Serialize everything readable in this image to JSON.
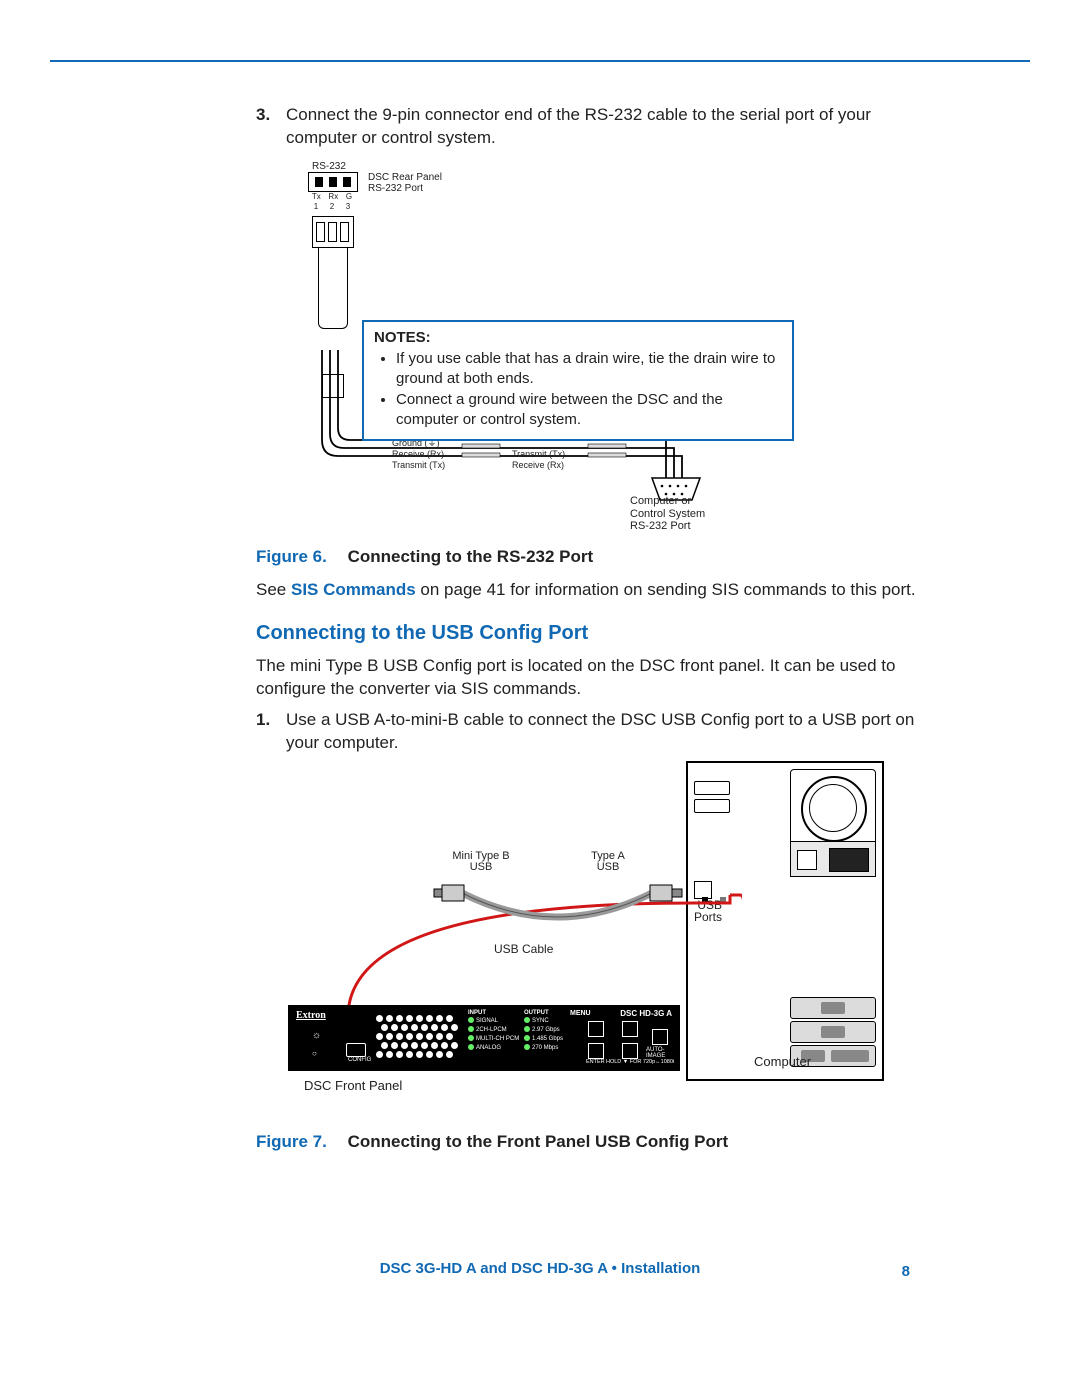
{
  "step3": {
    "num": "3.",
    "text": "Connect the 9-pin connector end of the RS-232 cable to the serial port of your computer or control system."
  },
  "fig6": {
    "rs232": "RS-232",
    "rear_label_l1": "DSC Rear Panel",
    "rear_label_l2": "RS-232 Port",
    "pins": {
      "tx": "Tx",
      "rx": "Rx",
      "g": "G",
      "n1": "1",
      "n2": "2",
      "n3": "3"
    },
    "wires_left": [
      "Ground (⏚)",
      "Receive (Rx)",
      "Transmit (Tx)"
    ],
    "wires_right": [
      "Transmit (Tx)",
      "Receive (Rx)"
    ],
    "computer_l1": "Computer or",
    "computer_l2": "Control System",
    "computer_l3": "RS-232 Port",
    "notes_title": "NOTES:",
    "notes": [
      "If you use cable that has a drain wire, tie the drain wire to ground at both ends.",
      "Connect a ground wire between the DSC and the computer or control system."
    ],
    "caption_link": "Figure 6.",
    "caption_title": "Connecting to the RS-232 Port"
  },
  "sis_para": {
    "pre": "See ",
    "link": "SIS Commands",
    "post": " on page 41 for information on sending SIS commands to this port."
  },
  "section_title": "Connecting to the USB Config Port",
  "usb_intro": "The mini Type B USB Config port is located on the DSC front panel. It can be used to configure the converter via SIS commands.",
  "step1": {
    "num": "1.",
    "text": "Use a USB A-to-mini-B cable to connect the DSC USB Config port to a USB port on your computer."
  },
  "fig7": {
    "mini_l1": "Mini Type B",
    "mini_l2": "USB",
    "typea_l1": "Type A",
    "typea_l2": "USB",
    "usb_ports_l1": "USB",
    "usb_ports_l2": "Ports",
    "usb_cable": "USB Cable",
    "computer": "Computer",
    "dsc_front": "DSC Front Panel",
    "panel": {
      "brand": "Extron",
      "model": "DSC HD-3G A",
      "config": "CONFIG",
      "input_hdr": "INPUT",
      "output_hdr": "OUTPUT",
      "menu": "MENU",
      "enter": "ENTER",
      "auto_l1": "AUTO-",
      "auto_l2": "IMAGE",
      "hold": "HOLD ▼ FOR 720p↔1080i",
      "col1": [
        "SIGNAL",
        "2CH-LPCM",
        "MULTI-CH PCM",
        "ANALOG"
      ],
      "col2": [
        "SYNC",
        "2.97 Gbps",
        "1.485 Gbps",
        "270 Mbps"
      ]
    },
    "caption_link": "Figure 7.",
    "caption_title": "Connecting to the Front Panel USB Config Port"
  },
  "footer": {
    "text": "DSC 3G-HD A and DSC HD-3G A • Installation",
    "page": "8"
  }
}
